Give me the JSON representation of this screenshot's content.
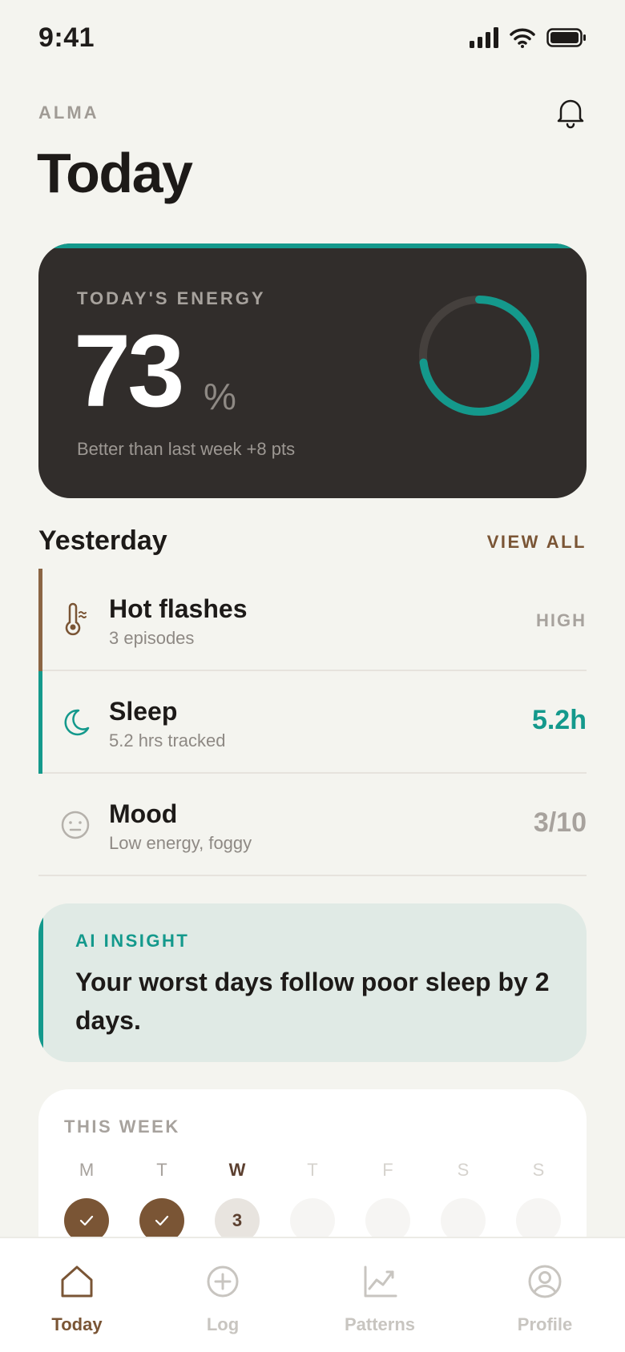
{
  "status_bar": {
    "time": "9:41"
  },
  "header": {
    "brand": "ALMA",
    "title": "Today"
  },
  "energy": {
    "label": "TODAY'S ENERGY",
    "value": "73",
    "unit": "%",
    "percent": 73,
    "subtitle": "Better than last week +8 pts"
  },
  "yesterday": {
    "title": "Yesterday",
    "view_all": "VIEW ALL",
    "items": [
      {
        "title": "Hot flashes",
        "subtitle": "3 episodes",
        "value": "HIGH",
        "icon": "thermometer-icon",
        "accent": "#8b6544"
      },
      {
        "title": "Sleep",
        "subtitle": "5.2 hrs tracked",
        "value": "5.2h",
        "icon": "moon-icon",
        "accent": "#14998c"
      },
      {
        "title": "Mood",
        "subtitle": "Low energy, foggy",
        "value": "3/10",
        "icon": "neutral-face-icon",
        "accent": ""
      }
    ]
  },
  "insight": {
    "label": "AI INSIGHT",
    "text": "Your worst days follow poor sleep by 2 days."
  },
  "week": {
    "label": "THIS WEEK",
    "days": [
      {
        "letter": "M",
        "state": "done",
        "mark": ""
      },
      {
        "letter": "T",
        "state": "done",
        "mark": ""
      },
      {
        "letter": "W",
        "state": "today",
        "mark": "3"
      },
      {
        "letter": "T",
        "state": "future",
        "mark": ""
      },
      {
        "letter": "F",
        "state": "future",
        "mark": ""
      },
      {
        "letter": "S",
        "state": "future",
        "mark": ""
      },
      {
        "letter": "S",
        "state": "future",
        "mark": ""
      }
    ]
  },
  "tabs": [
    {
      "label": "Today",
      "icon": "home-icon",
      "active": true
    },
    {
      "label": "Log",
      "icon": "plus-circle-icon",
      "active": false
    },
    {
      "label": "Patterns",
      "icon": "chart-icon",
      "active": false
    },
    {
      "label": "Profile",
      "icon": "profile-icon",
      "active": false
    }
  ],
  "colors": {
    "accent_teal": "#14998c",
    "accent_brown": "#7a5535",
    "card_dark": "#312d2b",
    "background": "#f4f4ef"
  }
}
